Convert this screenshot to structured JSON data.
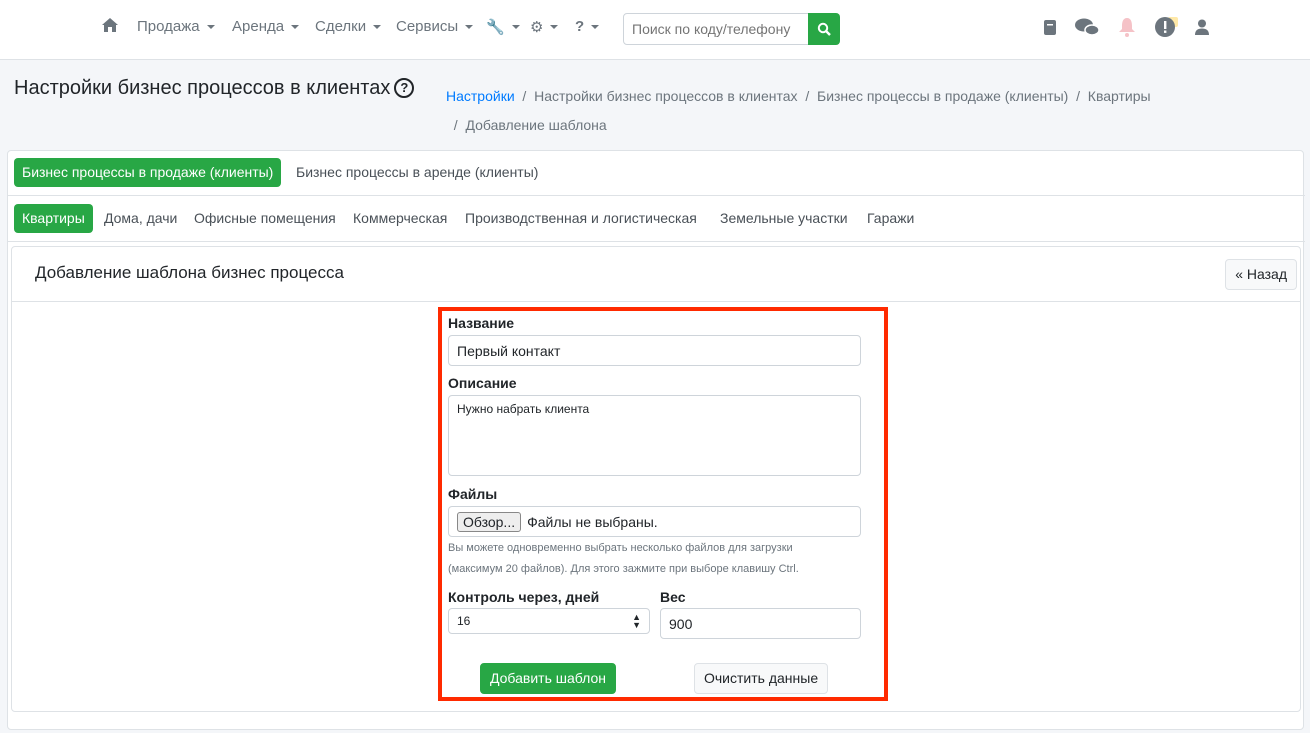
{
  "nav": {
    "items": [
      "Продажа",
      "Аренда",
      "Сделки",
      "Сервисы"
    ],
    "search_placeholder": "Поиск по коду/телефону"
  },
  "page": {
    "title": "Настройки бизнес процессов в клиентах",
    "help": "?"
  },
  "breadcrumb": [
    "Настройки",
    "Настройки бизнес процессов в клиентах",
    "Бизнес процессы в продаже (клиенты)",
    "Квартиры",
    "Добавление шаблона"
  ],
  "tabs_top": [
    "Бизнес процессы в продаже (клиенты)",
    "Бизнес процессы в аренде (клиенты)"
  ],
  "tabs_sub": [
    "Квартиры",
    "Дома, дачи",
    "Офисные помещения",
    "Коммерческая",
    "Производственная и логистическая",
    "Земельные участки",
    "Гаражи"
  ],
  "form": {
    "header": "Добавление шаблона бизнес процесса",
    "back": "« Назад",
    "name_label": "Название",
    "name_value": "Первый контакт",
    "desc_label": "Описание",
    "desc_value": "Нужно набрать клиента",
    "files_label": "Файлы",
    "browse": "Обзор...",
    "no_files": "Файлы не выбраны.",
    "help1": "Вы можете одновременно выбрать несколько файлов для загрузки",
    "help2": "(максимум 20 файлов). Для этого зажмите при выборе клавишу Ctrl.",
    "control_label": "Контроль через, дней",
    "control_value": "16",
    "weight_label": "Вес",
    "weight_value": "900",
    "submit": "Добавить шаблон",
    "clear": "Очистить данные"
  },
  "colors": {
    "accent": "#28a745",
    "highlight": "#ff2a00",
    "link": "#007bff"
  }
}
